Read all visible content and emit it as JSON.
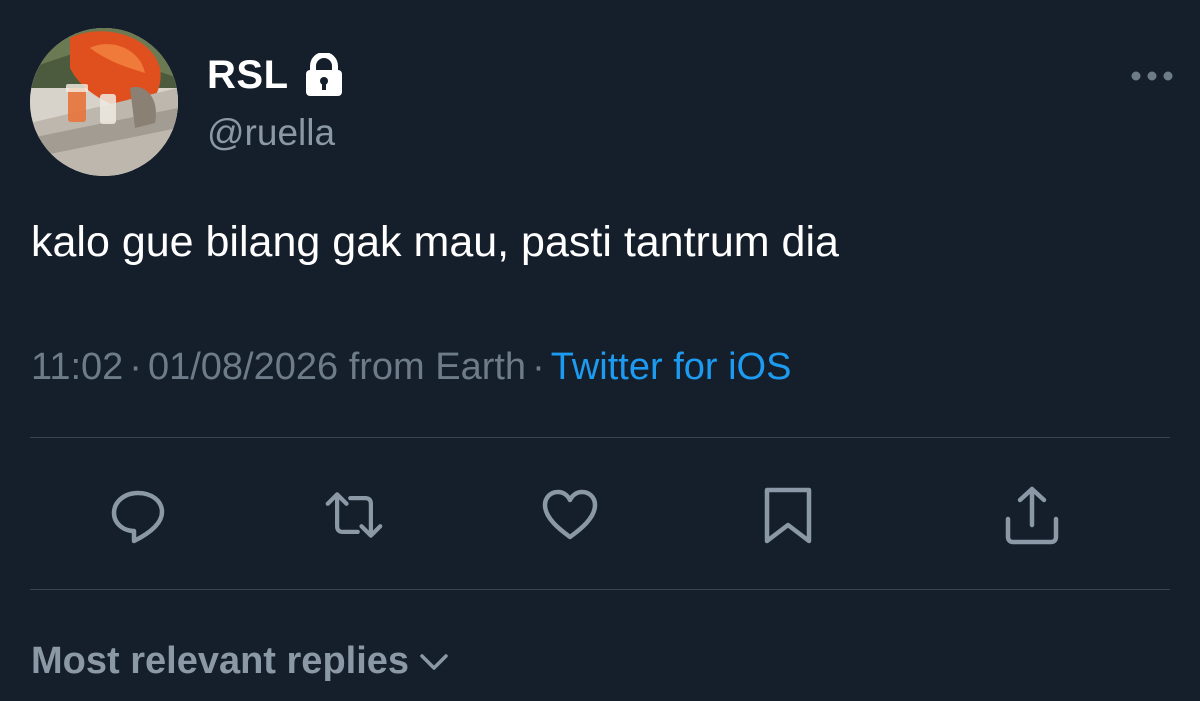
{
  "tweet": {
    "display_name": "RSL",
    "handle": "@ruella",
    "text": "kalo gue bilang gak mau, pasti tantrum dia",
    "time": "11:02",
    "date": "01/08/2026",
    "location": "from Earth",
    "separator": "·",
    "source": "Twitter for iOS"
  },
  "icons": {
    "lock": "lock-icon",
    "more": "more-horizontal-icon",
    "reply": "reply-bubble-icon",
    "retweet": "retweet-icon",
    "like": "heart-icon",
    "bookmark": "bookmark-icon",
    "share": "share-icon",
    "chevron": "chevron-down-icon"
  },
  "replies_filter": {
    "label": "Most relevant replies"
  },
  "colors": {
    "background": "#151e2b",
    "accent": "#1d9bf0",
    "secondary_text": "#8b98a5",
    "meta_text": "#6e7b88",
    "divider": "#38444d"
  }
}
